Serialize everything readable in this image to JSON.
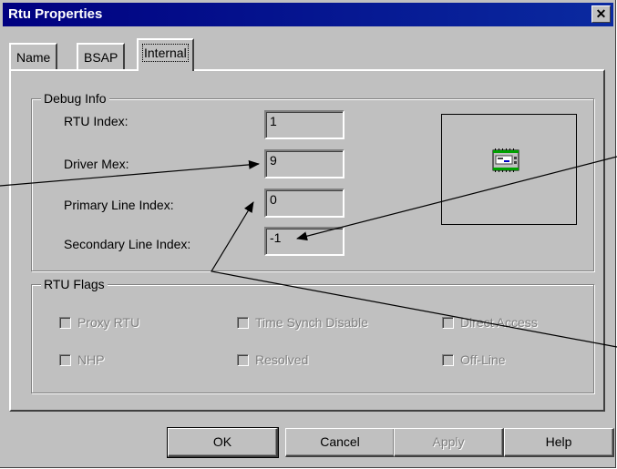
{
  "window": {
    "title": "Rtu Properties",
    "close_glyph": "✕"
  },
  "tabs": [
    {
      "label": "Name",
      "active": false
    },
    {
      "label": "BSAP",
      "active": false
    },
    {
      "label": "Internal",
      "active": true
    }
  ],
  "debug_info": {
    "title": "Debug Info",
    "fields": [
      {
        "label": "RTU Index:",
        "value": "1"
      },
      {
        "label": "Driver Mex:",
        "value": "9"
      },
      {
        "label": "Primary Line Index:",
        "value": "0"
      },
      {
        "label": "Secondary Line Index:",
        "value": "-1"
      }
    ],
    "preview_icon": "rtu-device-icon"
  },
  "rtu_flags": {
    "title": "RTU Flags",
    "items": [
      {
        "label": "Proxy RTU",
        "checked": false,
        "enabled": false
      },
      {
        "label": "Time Synch Disable",
        "checked": false,
        "enabled": false
      },
      {
        "label": "Direct Access",
        "checked": false,
        "enabled": false
      },
      {
        "label": "NHP",
        "checked": false,
        "enabled": false
      },
      {
        "label": "Resolved",
        "checked": false,
        "enabled": false
      },
      {
        "label": "Off-Line",
        "checked": false,
        "enabled": false
      }
    ]
  },
  "buttons": {
    "ok": "OK",
    "cancel": "Cancel",
    "apply": "Apply",
    "help": "Help"
  },
  "colors": {
    "face": "#c0c0c0",
    "title_bar": "#000080",
    "disabled_text": "#808080"
  }
}
